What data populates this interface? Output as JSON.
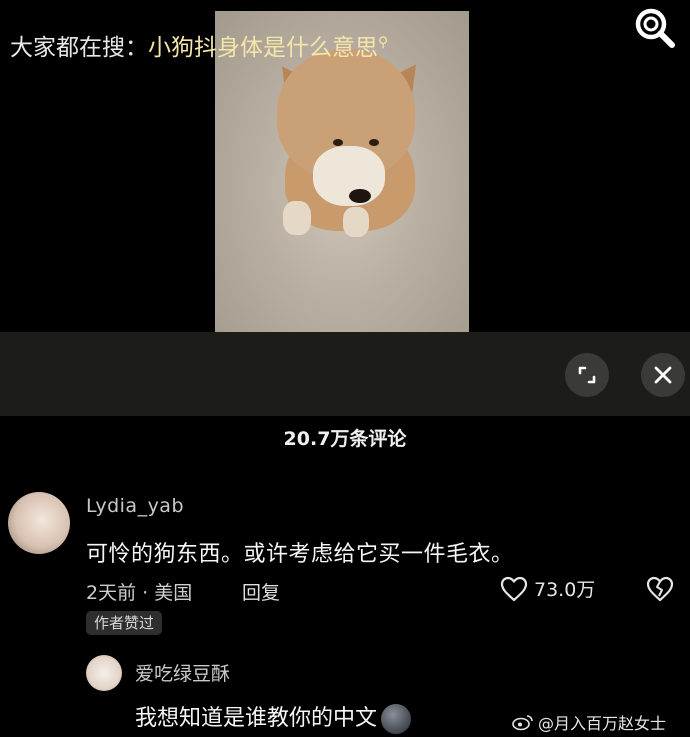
{
  "search_suggestion": {
    "prefix": "大家都在搜：",
    "query": "小狗抖身体是什么意思"
  },
  "comments_header": {
    "count_label": "20.7万条评论"
  },
  "comments": [
    {
      "username": "Lydia_yab",
      "text": "可怜的狗东西。或许考虑给它买一件毛衣。",
      "meta": "2天前 · 美国",
      "reply_label": "回复",
      "like_count": "73.0万",
      "badge": "作者赞过"
    },
    {
      "username": "爱吃绿豆酥",
      "text": "我想知道是谁教你的中文"
    }
  ],
  "watermark": "@月入百万赵女士",
  "icons": {
    "search": "search-icon",
    "expand": "expand-icon",
    "close": "close-icon",
    "like": "heart-icon",
    "dislike": "broken-heart-icon",
    "weibo": "weibo-logo-icon"
  }
}
